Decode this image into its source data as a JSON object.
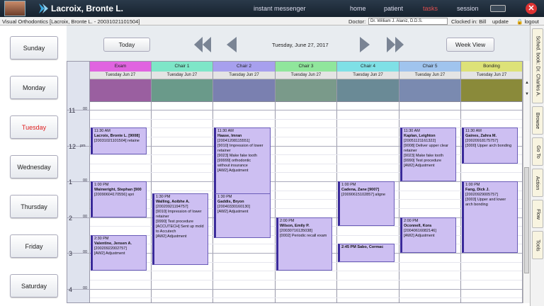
{
  "header": {
    "patient_name": "Lacroix, Bronte L.",
    "nav": [
      "instant messenger",
      "home",
      "patient",
      "tasks",
      "session"
    ],
    "close_glyph": "✕"
  },
  "infobar": {
    "practice": "Visual Orthodontics [Lacroix, Bronte L. - 20031021101504]",
    "doctor_label": "Doctor:",
    "doctor_value": "Dr. William J. Alaniz, D.D.S.",
    "clocked": "Clocked in: Bill",
    "update": "update",
    "logout": "logout"
  },
  "days": [
    "Sunday",
    "Monday",
    "Tuesday",
    "Wednesday",
    "Thursday",
    "Friday",
    "Saturday"
  ],
  "active_day": "Tuesday",
  "toolbar": {
    "today": "Today",
    "date": "Tuesday, June 27, 2017",
    "week_view": "Week View"
  },
  "columns": [
    {
      "name": "Exam",
      "date": "Tuesday Jun 27",
      "head": "#e064e0",
      "band": "#9a5fa0"
    },
    {
      "name": "Chair 1",
      "date": "Tuesday Jun 27",
      "head": "#7ee6c8",
      "band": "#6a9a8a"
    },
    {
      "name": "Chair 2",
      "date": "Tuesday Jun 27",
      "head": "#a7a0ee",
      "band": "#7a80b0"
    },
    {
      "name": "Chair 3",
      "date": "Tuesday Jun 27",
      "head": "#90e69c",
      "band": "#7a9a8a"
    },
    {
      "name": "Chair 4",
      "date": "Tuesday Jun 27",
      "head": "#7fe0e6",
      "band": "#6a8a96"
    },
    {
      "name": "Chair 5",
      "date": "Tuesday Jun 27",
      "head": "#a0c4ee",
      "band": "#7a8ab0"
    },
    {
      "name": "Bonding",
      "date": "Tuesday Jun 27",
      "head": "#dde278",
      "band": "#8a8a3a"
    }
  ],
  "hours": [
    {
      "h": "11",
      "m": "00",
      "pm": ""
    },
    {
      "h": "12",
      "m": "",
      "pm": "pm"
    },
    {
      "h": "1",
      "m": "00",
      "pm": ""
    },
    {
      "h": "2",
      "m": "00",
      "pm": ""
    },
    {
      "h": "3",
      "m": "00",
      "pm": ""
    },
    {
      "h": "4",
      "m": "00",
      "pm": ""
    }
  ],
  "appointments": [
    {
      "col": 0,
      "start": 11.5,
      "end": 12.25,
      "lines": [
        "11:30 AM",
        "Lacroix, Bronte L. [9008]",
        "[20031021101504] retaine"
      ]
    },
    {
      "col": 0,
      "start": 13.0,
      "end": 14.0,
      "lines": [
        "1:00 PM",
        "Wainwright, Stephan [900",
        "[20090604170556] spri"
      ]
    },
    {
      "col": 0,
      "start": 14.5,
      "end": 15.5,
      "lines": [
        "2:30 PM",
        "Valentine, Jensen A.",
        "[20020922002757]",
        "[AW2] Adjustment"
      ]
    },
    {
      "col": 1,
      "start": 13.33,
      "end": 15.33,
      "lines": [
        "1:30 PM",
        "Walling, Aoibhe A.",
        "[20020921194757]",
        "[9010] Impression of lower",
        "retainer",
        "[9990] Test procedure",
        "[ACCUTECH] Sent up mold",
        "to Accutech",
        "[AW2] Adjustment"
      ]
    },
    {
      "col": 2,
      "start": 11.5,
      "end": 13.5,
      "lines": [
        "11:30 AM",
        "Haase, Imran",
        "[20041208115551]",
        "[9010] Impression of lower",
        "retainer",
        "[9023] Make fake tooth",
        "[99999] orthodontic",
        "without insurance",
        "[AW2] Adjustment"
      ]
    },
    {
      "col": 2,
      "start": 13.33,
      "end": 14.58,
      "lines": [
        "1:30 PM",
        "Gaddis, Bryon",
        "[20040330160130]",
        "[AW2] Adjustment"
      ]
    },
    {
      "col": 3,
      "start": 14.0,
      "end": 15.5,
      "lines": [
        "2:00 PM",
        "Wilson, Emily P.",
        "[20030716135038]",
        "[0002] Periodic recall exam"
      ]
    },
    {
      "col": 4,
      "start": 13.0,
      "end": 14.25,
      "lines": [
        "1:00 PM",
        "Cadena, Zane [9007]",
        "[20090615102857] aligne"
      ]
    },
    {
      "col": 4,
      "start": 14.75,
      "end": 15.25,
      "lines": [
        "2:45 PM Sabo, Cormac"
      ]
    },
    {
      "col": 5,
      "start": 11.5,
      "end": 13.0,
      "lines": [
        "11:30 AM",
        "Kaplan, Leighton",
        "[20051121161322]",
        "[9008] Deliver upper clear",
        "retainer",
        "[9023] Make fake tooth",
        "[9990] Test procedure",
        "[AW2] Adjustment"
      ]
    },
    {
      "col": 5,
      "start": 14.0,
      "end": 15.0,
      "lines": [
        "2:00 PM",
        "Oconnell, Kora",
        "[20040616082146]",
        "[AW2] Adjustment"
      ]
    },
    {
      "col": 6,
      "start": 11.5,
      "end": 12.5,
      "lines": [
        "11:30 AM",
        "Gaines, Zahra M.",
        "[20020918175757]",
        "[3000] Upper arch bonding"
      ]
    },
    {
      "col": 6,
      "start": 13.0,
      "end": 15.0,
      "lines": [
        "1:00 PM",
        "Fang, Dick J.",
        "[20020929005757]",
        "[3003] Upper and lower",
        "arch bonding"
      ]
    }
  ],
  "sidetabs": [
    "Sched. book: Dr. Charles A.",
    "Browse",
    "Go To",
    "Action",
    "Flow",
    "Tools"
  ]
}
